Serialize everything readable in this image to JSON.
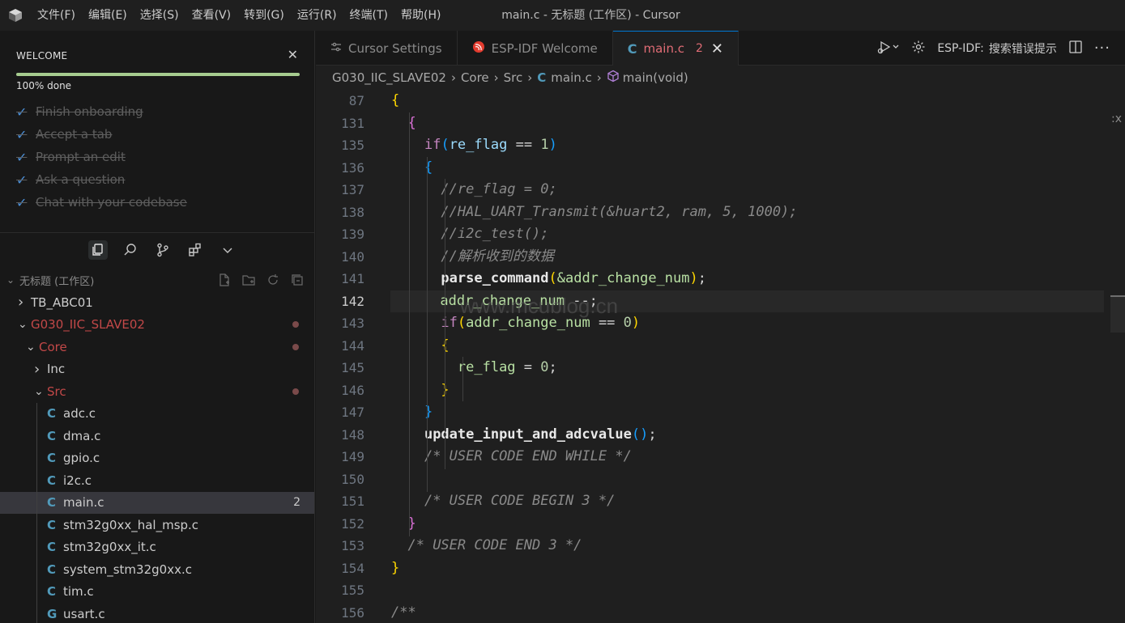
{
  "titlebar": {
    "menu": [
      "文件(F)",
      "编辑(E)",
      "选择(S)",
      "查看(V)",
      "转到(G)",
      "运行(R)",
      "终端(T)",
      "帮助(H)"
    ],
    "window_title": "main.c - 无标题 (工作区) - Cursor"
  },
  "welcome": {
    "title": "WELCOME",
    "progress_text": "100% done",
    "progress_fraction": 1.0,
    "items": [
      "Finish onboarding",
      "Accept a tab",
      "Prompt an edit",
      "Ask a question",
      "Chat with your codebase"
    ]
  },
  "explorer": {
    "workspace": "无标题 (工作区)",
    "tree": [
      {
        "label": "TB_ABC01",
        "type": "folder",
        "open": false,
        "level": 0
      },
      {
        "label": "G030_IIC_SLAVE02",
        "type": "folder",
        "open": true,
        "level": 0,
        "modified": true
      },
      {
        "label": "Core",
        "type": "folder",
        "open": true,
        "level": 1,
        "modified": true
      },
      {
        "label": "Inc",
        "type": "folder",
        "open": false,
        "level": 2
      },
      {
        "label": "Src",
        "type": "folder",
        "open": true,
        "level": 2,
        "modified": true
      },
      {
        "label": "adc.c",
        "type": "c",
        "level": 3
      },
      {
        "label": "dma.c",
        "type": "c",
        "level": 3
      },
      {
        "label": "gpio.c",
        "type": "c",
        "level": 3
      },
      {
        "label": "i2c.c",
        "type": "c",
        "level": 3
      },
      {
        "label": "main.c",
        "type": "c",
        "level": 3,
        "selected": true,
        "badge": "2"
      },
      {
        "label": "stm32g0xx_hal_msp.c",
        "type": "c",
        "level": 3
      },
      {
        "label": "stm32g0xx_it.c",
        "type": "c",
        "level": 3
      },
      {
        "label": "system_stm32g0xx.c",
        "type": "c",
        "level": 3
      },
      {
        "label": "tim.c",
        "type": "c",
        "level": 3
      },
      {
        "label": "usart.c",
        "type": "c2",
        "level": 3
      }
    ]
  },
  "tabs": [
    {
      "label": "Cursor Settings",
      "icon": "settings-icon"
    },
    {
      "label": "ESP-IDF Welcome",
      "icon": "espressif-icon"
    },
    {
      "label": "main.c",
      "icon": "c-file-icon",
      "active": true,
      "problems": "2"
    }
  ],
  "tab_actions": {
    "esp_label": "ESP-IDF:",
    "search_label": "搜索错误提示"
  },
  "breadcrumb": [
    "G030_IIC_SLAVE02",
    "Core",
    "Src",
    "main.c",
    "main(void)"
  ],
  "editor": {
    "line_numbers": [
      "87",
      "131",
      "135",
      "136",
      "137",
      "138",
      "139",
      "140",
      "141",
      "142",
      "143",
      "144",
      "145",
      "146",
      "147",
      "148",
      "149",
      "150",
      "151",
      "152",
      "153",
      "154",
      "155",
      "156"
    ],
    "current_line": "142",
    "watermark": "www.mcublog.cn",
    "corner_text": ":x"
  }
}
